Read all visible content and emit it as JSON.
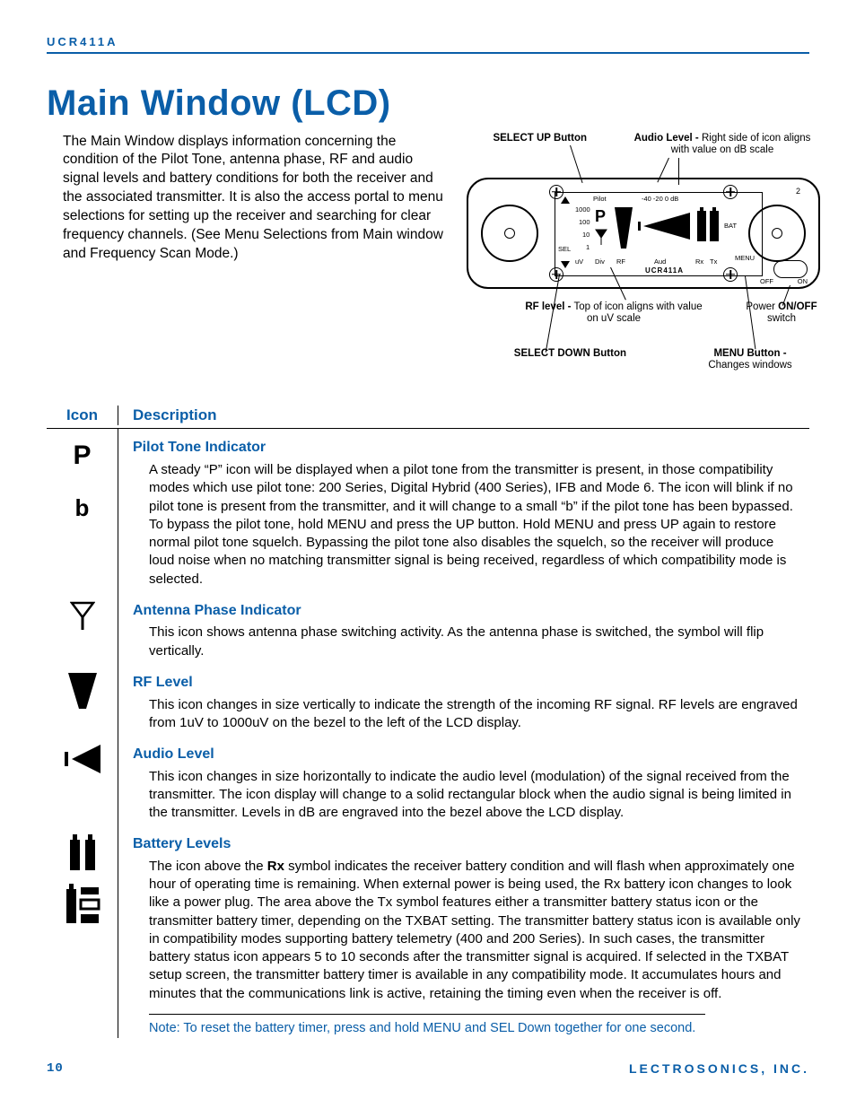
{
  "header": {
    "model": "UCR411A"
  },
  "title": "Main Window (LCD)",
  "intro": "The Main Window displays information concerning the condition of the Pilot Tone, antenna phase, RF and audio signal levels and battery conditions for both the receiver and the associated transmitter. It is also the access portal to menu selections for setting up the receiver and searching for clear frequency channels. (See Menu Selections from Main window and Frequency Scan Mode.)",
  "figure": {
    "select_up": "SELECT UP Button",
    "audio_level_label": "Audio Level -",
    "audio_level_text": " Right side of icon aligns with value on dB scale",
    "rf_level_label": "RF level -",
    "rf_level_text": " Top of icon aligns with value on uV scale",
    "power_label": "Power ",
    "power_bold": "ON/OFF",
    "power_text2": " switch",
    "select_down": "SELECT DOWN Button",
    "menu_label": "MENU Button -",
    "menu_text": "Changes windows",
    "lcd": {
      "pilot": "Pilot",
      "db_scale": "-40 -20  0 dB",
      "uv_1000": "1000",
      "uv_100": "100",
      "uv_10": "10",
      "uv_1": "1",
      "sel": "SEL",
      "uv": "uV",
      "div": "Div",
      "rf": "RF",
      "aud": "Aud",
      "rx": "Rx",
      "tx": "Tx",
      "bat": "BAT",
      "menu": "MENU",
      "off": "OFF",
      "on": "ON",
      "model": "UCR411A",
      "two": "2"
    }
  },
  "table": {
    "head_icon": "Icon",
    "head_desc": "Description",
    "rows": [
      {
        "id": "pilot",
        "heading": "Pilot Tone Indicator",
        "body": "A steady “P” icon will be displayed when a pilot tone from the transmitter is present, in those compatibility modes which use pilot tone:  200 Series, Digital Hybrid (400 Series), IFB and Mode 6. The icon will blink if no pilot tone is present from the transmitter, and it will change to a small “b” if the pilot tone has been bypassed.  To bypass the pilot tone, hold MENU and press the UP button. Hold MENU and press UP again to restore normal pilot tone squelch. Bypassing the pilot tone also disables the squelch, so the receiver will produce loud noise when no matching transmitter signal is being received, regardless of which compatibility mode is selected."
      },
      {
        "id": "antenna",
        "heading": "Antenna Phase Indicator",
        "body": "This icon shows antenna phase switching activity.  As the antenna phase is switched, the symbol will flip vertically."
      },
      {
        "id": "rf",
        "heading": "RF Level",
        "body": "This icon changes in size vertically to indicate the strength of the incoming RF signal.  RF levels are engraved from 1uV to 1000uV on the bezel to the left of the LCD display."
      },
      {
        "id": "audio",
        "heading": "Audio Level",
        "body": "This icon changes in size horizontally to indicate the audio level (modulation) of the signal received from the transmitter.  The icon display will change to a solid rectangular block when the audio signal is being limited in the transmitter.  Levels in dB are engraved into the bezel above the LCD display."
      },
      {
        "id": "battery",
        "heading": "Battery Levels",
        "body_pre": "The icon above the ",
        "body_bold": "Rx",
        "body_post": " symbol indicates the receiver battery condition and will flash when approximately one hour of operating time is remaining. When external power is being used, the Rx battery icon changes to look like a power plug. The area above the Tx symbol features either a transmitter battery status icon or the transmitter battery timer, depending on the TXBAT setting. The transmitter battery status icon is available only in compatibility modes supporting battery telemetry (400 and 200 Series). In such cases, the transmitter battery status icon appears 5 to 10 seconds after the transmitter signal is acquired. If selected in the TXBAT setup screen, the transmitter battery timer is available in any compatibility mode. It accumulates hours and minutes that the communications link is active, retaining the timing even when the receiver is off."
      }
    ],
    "note": "Note: To reset the battery timer, press and hold MENU and SEL Down together for one second."
  },
  "footer": {
    "page": "10",
    "brand": "LECTROSONICS, INC."
  }
}
